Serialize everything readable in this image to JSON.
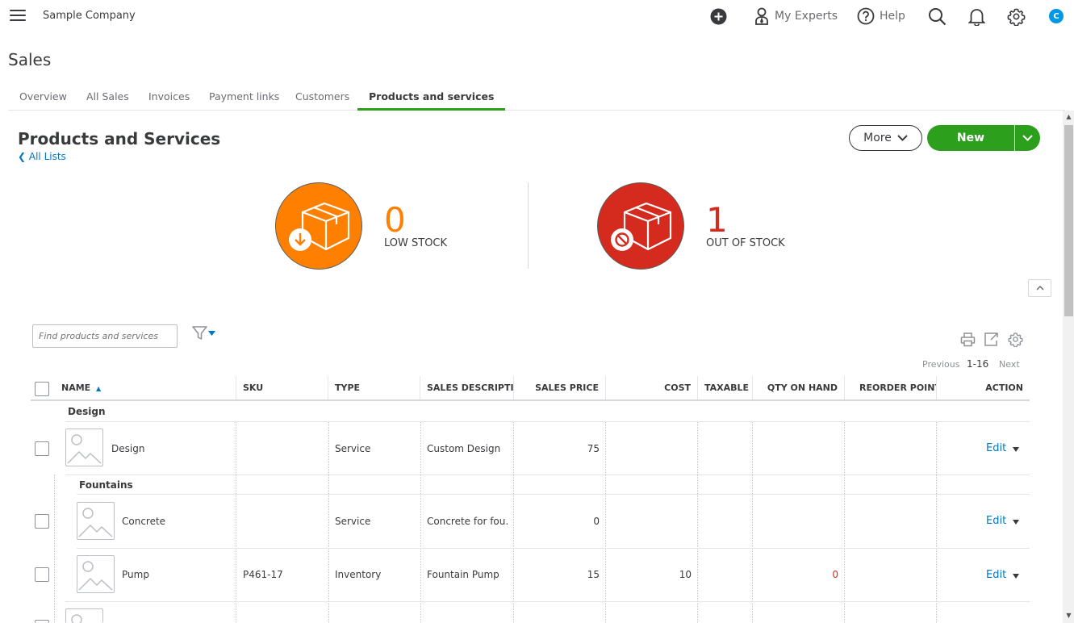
{
  "topbar": {
    "company": "Sample Company",
    "my_experts": "My Experts",
    "help": "Help",
    "avatar_letter": "C"
  },
  "page": {
    "title": "Sales"
  },
  "tabs": [
    {
      "label": "Overview"
    },
    {
      "label": "All Sales"
    },
    {
      "label": "Invoices"
    },
    {
      "label": "Payment links"
    },
    {
      "label": "Customers"
    },
    {
      "label": "Products and services",
      "active": true
    }
  ],
  "header": {
    "title": "Products and Services",
    "back_link": "All Lists",
    "more_label": "More",
    "new_label": "New"
  },
  "stock": {
    "low": {
      "count": "0",
      "label": "LOW STOCK",
      "color": "#ff8000"
    },
    "out": {
      "count": "1",
      "label": "OUT OF STOCK",
      "color": "#d52b1e"
    }
  },
  "search": {
    "placeholder": "Find products and services"
  },
  "pagination": {
    "previous": "Previous",
    "range": "1-16",
    "next": "Next"
  },
  "table": {
    "columns": {
      "name": "NAME",
      "sku": "SKU",
      "type": "TYPE",
      "sales_description": "SALES DESCRIPTION",
      "sales_price": "SALES PRICE",
      "cost": "COST",
      "taxable": "TAXABLE",
      "qty_on_hand": "QTY ON HAND",
      "reorder_point": "REORDER POINT",
      "action": "ACTION"
    },
    "groups": [
      {
        "name": "Design"
      },
      {
        "name": "Fountains"
      }
    ],
    "rows": [
      {
        "name": "Design",
        "sku": "",
        "type": "Service",
        "description": "Custom Design",
        "price": "75",
        "cost": "",
        "qty": "",
        "action": "Edit"
      },
      {
        "name": "Concrete",
        "sku": "",
        "type": "Service",
        "description": "Concrete for fou…",
        "price": "0",
        "cost": "",
        "qty": "",
        "action": "Edit"
      },
      {
        "name": "Pump",
        "sku": "P461-17",
        "type": "Inventory",
        "description": "Fountain Pump",
        "price": "15",
        "cost": "10",
        "qty": "0",
        "action": "Edit"
      }
    ]
  },
  "colors": {
    "accent": "#2ca01c",
    "link": "#0077c5",
    "alert": "#d52b1e"
  }
}
